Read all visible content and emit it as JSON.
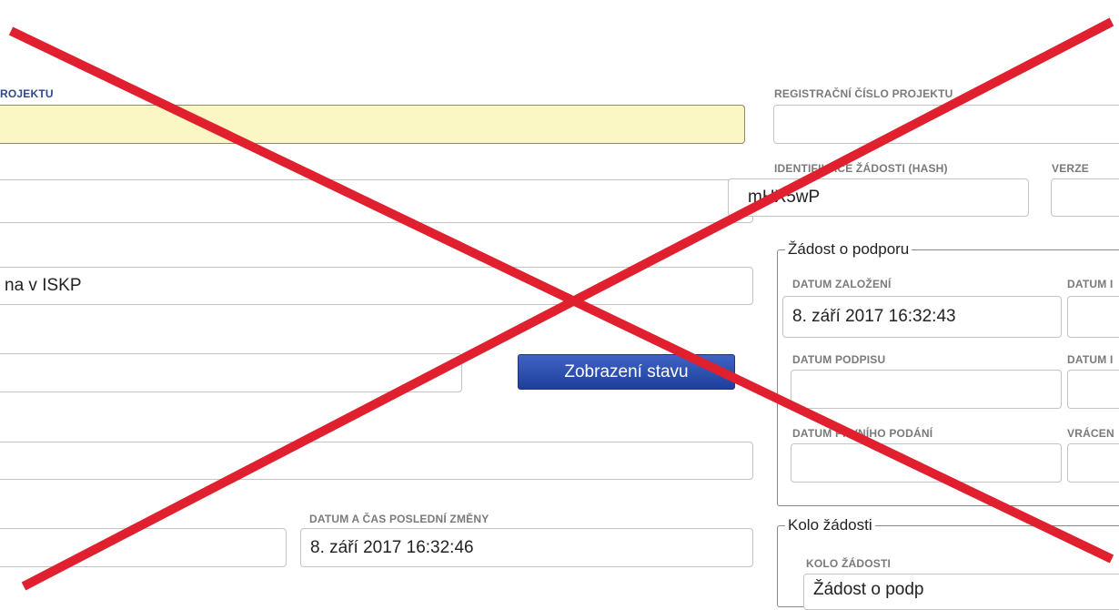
{
  "left": {
    "project_label_partial": "ROJEKTU",
    "state_value_partial": "na v ISKP",
    "status_button_label": "Zobrazení stavu",
    "last_change_label": "DATUM A ČAS POSLEDNÍ ZMĚNY",
    "last_change_value": "8. září 2017 16:32:46"
  },
  "right": {
    "reg_number_label": "REGISTRAČNÍ ČÍSLO PROJEKTU",
    "hash_label": "IDENTIFIKACE ŽÁDOSTI (HASH)",
    "hash_value": "mHX5wP",
    "version_label": "VERZE",
    "support_group": {
      "title": "Žádost o podporu",
      "created_label": "DATUM ZALOŽENÍ",
      "created_value": "8. září 2017 16:32:43",
      "col2_label_partial": "DATUM I",
      "signature_label": "DATUM PODPISU",
      "col2_row2_label_partial": "DATUM I",
      "first_submit_label": "DATUM PRVNÍHO PODÁNÍ",
      "returned_label_partial": "VRÁCEN"
    },
    "round_group": {
      "title": "Kolo žádosti",
      "round_label": "KOLO ŽÁDOSTI",
      "round_value_partial": "Žádost o podp"
    }
  },
  "overlay": {
    "cross_color": "#e0202f"
  }
}
